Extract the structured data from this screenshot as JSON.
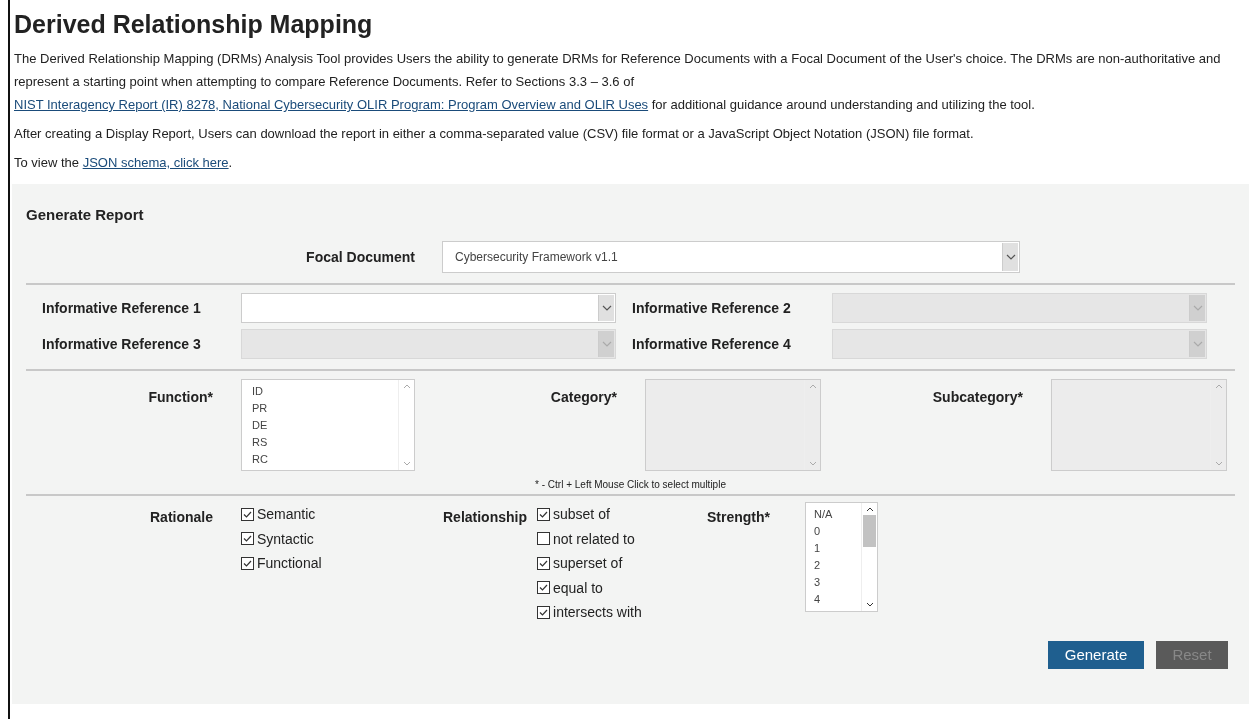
{
  "title": "Derived Relationship Mapping",
  "intro": {
    "before": "The Derived Relationship Mapping (DRMs) Analysis Tool provides Users the ability to generate DRMs for Reference Documents with a Focal Document of the User's choice. The DRMs are non-authoritative and represent a starting point when attempting to compare Reference Documents. Refer to Sections 3.3 – 3.6 of",
    "link": "NIST Interagency Report (IR) 8278, National Cybersecurity OLIR Program: Program Overview and OLIR Uses",
    "after": "for additional guidance around understanding and utilizing the tool."
  },
  "download_note": "After creating a Display Report, Users can download the report in either a comma-separated value (CSV) file format or a JavaScript Object Notation (JSON) file format.",
  "schema": {
    "before": "To view the",
    "link": "JSON schema, click here",
    "after": "."
  },
  "form": {
    "title": "Generate Report",
    "focal": {
      "label": "Focal Document",
      "value": "Cybersecurity Framework v1.1",
      "disabled": false
    },
    "references": [
      {
        "label": "Informative Reference 1",
        "disabled": false
      },
      {
        "label": "Informative Reference 2",
        "disabled": true
      },
      {
        "label": "Informative Reference 3",
        "disabled": true
      },
      {
        "label": "Informative Reference 4",
        "disabled": true
      }
    ],
    "lists": [
      {
        "label": "Function*",
        "disabled": false,
        "options": [
          "ID",
          "PR",
          "DE",
          "RS",
          "RC"
        ]
      },
      {
        "label": "Category*",
        "disabled": true
      },
      {
        "label": "Subcategory*",
        "disabled": true
      }
    ],
    "hint": "* - Ctrl + Left Mouse Click to select multiple",
    "rationale": {
      "label": "Rationale",
      "options": [
        {
          "label": "Semantic",
          "checked": true
        },
        {
          "label": "Syntactic",
          "checked": true
        },
        {
          "label": "Functional",
          "checked": true
        }
      ]
    },
    "relationship": {
      "label": "Relationship",
      "options": [
        {
          "label": "subset of",
          "checked": true
        },
        {
          "label": "not related to",
          "checked": false
        },
        {
          "label": "superset of",
          "checked": true
        },
        {
          "label": "equal to",
          "checked": true
        },
        {
          "label": "intersects with",
          "checked": true
        }
      ]
    },
    "strength": {
      "label": "Strength*",
      "options": [
        "N/A",
        "0",
        "1",
        "2",
        "3",
        "4"
      ]
    },
    "buttons": [
      {
        "label": "Generate",
        "disabled": false
      },
      {
        "label": "Reset",
        "disabled": true
      }
    ]
  }
}
